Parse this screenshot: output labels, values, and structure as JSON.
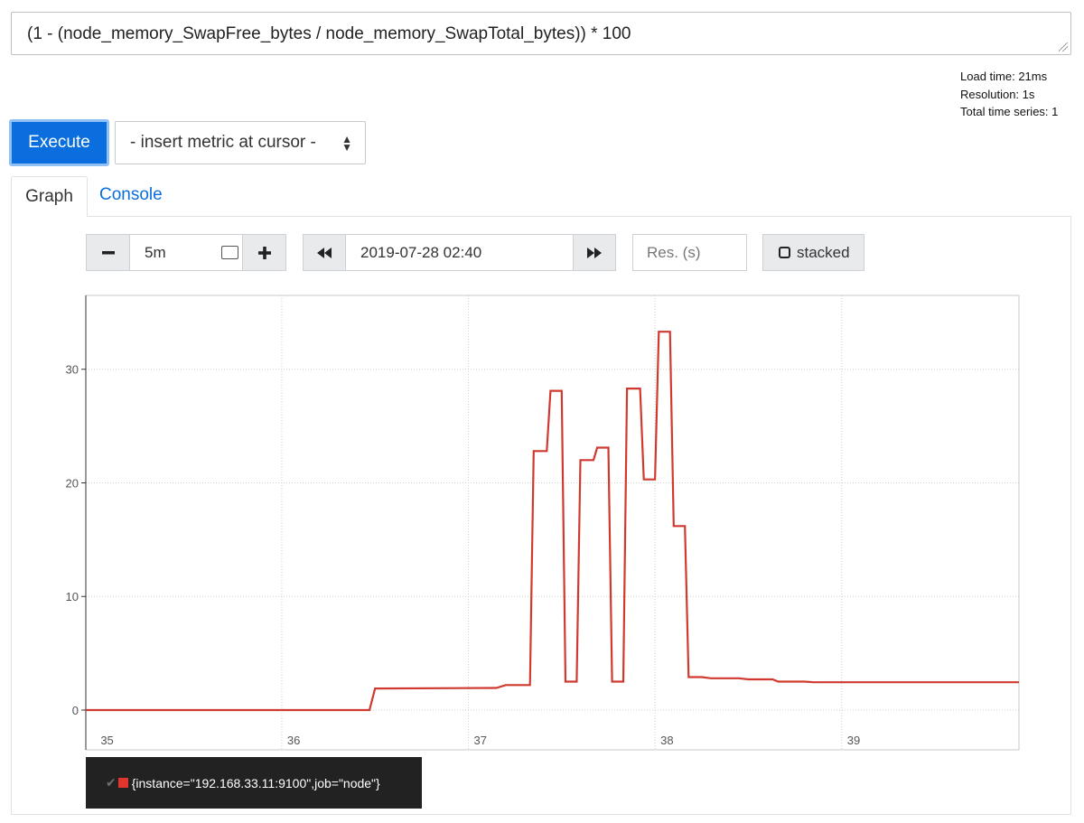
{
  "query": {
    "expression": "(1 - (node_memory_SwapFree_bytes / node_memory_SwapTotal_bytes)) * 100"
  },
  "stats": {
    "load_time": "Load time: 21ms",
    "resolution": "Resolution: 1s",
    "total_series": "Total time series: 1"
  },
  "toolbar": {
    "execute_label": "Execute",
    "metric_select_value": "- insert metric at cursor -"
  },
  "tabs": [
    {
      "label": "Graph",
      "active": true
    },
    {
      "label": "Console",
      "active": false
    }
  ],
  "graph_controls": {
    "range_value": "5m",
    "end_time_value": "2019-07-28 02:40",
    "resolution_placeholder": "Res. (s)",
    "stacked_label": "stacked"
  },
  "legend": {
    "series_label": "{instance=\"192.168.33.11:9100\",job=\"node\"}",
    "series_color": "#d0392f"
  },
  "chart_data": {
    "type": "line",
    "title": "",
    "xlabel": "",
    "ylabel": "",
    "xlim": [
      34.95,
      39.95
    ],
    "ylim": [
      -3.5,
      36.5
    ],
    "x_ticks": [
      "35",
      "36",
      "37",
      "38",
      "39"
    ],
    "y_ticks": [
      "0",
      "10",
      "20",
      "30"
    ],
    "grid": true,
    "series": [
      {
        "name": "{instance=\"192.168.33.11:9100\",job=\"node\"}",
        "color": "#d0392f",
        "step": true,
        "points": [
          [
            34.95,
            0
          ],
          [
            36.47,
            0
          ],
          [
            36.5,
            1.9
          ],
          [
            37.15,
            1.95
          ],
          [
            37.2,
            2.2
          ],
          [
            37.33,
            2.2
          ],
          [
            37.35,
            22.8
          ],
          [
            37.42,
            22.8
          ],
          [
            37.44,
            28.1
          ],
          [
            37.5,
            28.1
          ],
          [
            37.52,
            2.5
          ],
          [
            37.58,
            2.5
          ],
          [
            37.6,
            22.0
          ],
          [
            37.67,
            22.0
          ],
          [
            37.69,
            23.1
          ],
          [
            37.75,
            23.1
          ],
          [
            37.77,
            2.5
          ],
          [
            37.83,
            2.5
          ],
          [
            37.85,
            28.3
          ],
          [
            37.92,
            28.3
          ],
          [
            37.94,
            20.3
          ],
          [
            38.0,
            20.3
          ],
          [
            38.02,
            33.3
          ],
          [
            38.08,
            33.3
          ],
          [
            38.1,
            16.2
          ],
          [
            38.16,
            16.2
          ],
          [
            38.18,
            2.9
          ],
          [
            38.25,
            2.9
          ],
          [
            38.3,
            2.8
          ],
          [
            38.45,
            2.8
          ],
          [
            38.5,
            2.7
          ],
          [
            38.63,
            2.7
          ],
          [
            38.66,
            2.5
          ],
          [
            38.8,
            2.5
          ],
          [
            38.85,
            2.45
          ],
          [
            39.95,
            2.45
          ]
        ]
      }
    ]
  }
}
